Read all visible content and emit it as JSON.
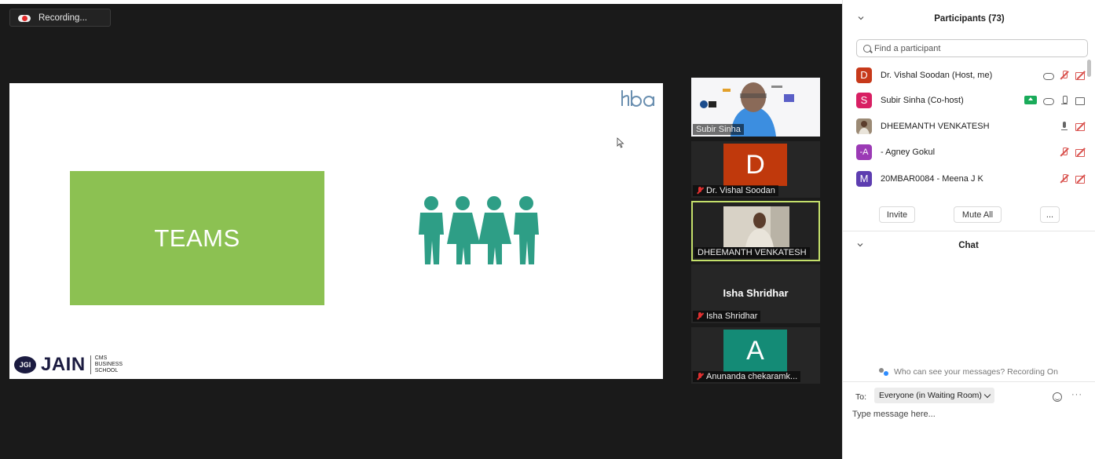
{
  "recording": {
    "label": "Recording..."
  },
  "slide": {
    "teams_label": "TEAMS",
    "brand_short": "JGI",
    "brand_name": "JAIN",
    "school_line1": "CMS",
    "school_line2": "BUSINESS",
    "school_line3": "SCHOOL",
    "colors": {
      "teams_box": "#8cc152",
      "people": "#2e9e86"
    }
  },
  "videos": [
    {
      "name": "Subir Sinha",
      "kind": "camera"
    },
    {
      "name": "Dr. Vishal Soodan",
      "initial": "D",
      "color": "#c0390c",
      "muted": true
    },
    {
      "name": "DHEEMANTH VENKATESH",
      "kind": "camera",
      "active_speaker": true
    },
    {
      "name": "Isha Shridhar",
      "muted": true
    },
    {
      "name": "Anunanda chekaramk...",
      "initial": "A",
      "color": "#148b76",
      "muted": true
    }
  ],
  "participants_panel": {
    "title": "Participants (73)",
    "search_placeholder": "Find a participant",
    "list": [
      {
        "initial": "D",
        "color": "#c7391a",
        "name": "Dr. Vishal Soodan (Host, me)",
        "icons": [
          "cloud-icon",
          "mic-off-icon",
          "camera-off-icon"
        ]
      },
      {
        "initial": "S",
        "color": "#d81f63",
        "name": "Subir Sinha (Co-host)",
        "icons": [
          "share-screen-icon",
          "cloud-icon",
          "mic-icon",
          "camera-icon"
        ]
      },
      {
        "initial": "",
        "color": "#9b8a75",
        "name": "DHEEMANTH VENKATESH",
        "icons": [
          "mic-icon",
          "camera-off-icon"
        ]
      },
      {
        "initial": "-A",
        "color": "#9b3ab5",
        "name": "- Agney Gokul",
        "icons": [
          "mic-off-icon",
          "camera-off-icon"
        ]
      },
      {
        "initial": "M",
        "color": "#5d3db0",
        "name": "20MBAR0084 - Meena J K",
        "icons": [
          "mic-off-icon",
          "camera-off-icon"
        ]
      }
    ],
    "buttons": {
      "invite": "Invite",
      "mute_all": "Mute All",
      "more": "..."
    }
  },
  "chat_panel": {
    "title": "Chat",
    "notice": "Who can see your messages? Recording On",
    "to_label": "To:",
    "recipient": "Everyone (in Waiting Room)",
    "more": "···",
    "input_placeholder": "Type message here..."
  }
}
